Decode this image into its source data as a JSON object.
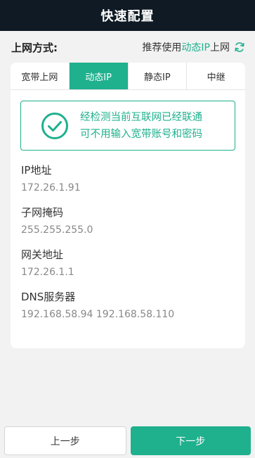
{
  "header": {
    "title": "快速配置"
  },
  "mode_row": {
    "label": "上网方式:",
    "recommend_prefix": "推荐使用",
    "recommend_accent": "动态IP",
    "recommend_suffix": "上网",
    "refresh_icon": "refresh-icon"
  },
  "tabs": [
    {
      "label": "宽带上网",
      "active": false
    },
    {
      "label": "动态IP",
      "active": true
    },
    {
      "label": "静态IP",
      "active": false
    },
    {
      "label": "中继",
      "active": false
    }
  ],
  "notice": {
    "icon": "check-circle-icon",
    "line1": "经检测当前互联网已经联通",
    "line2": "可不用输入宽带账号和密码"
  },
  "fields": [
    {
      "label": "IP地址",
      "value": "172.26.1.91"
    },
    {
      "label": "子网掩码",
      "value": "255.255.255.0"
    },
    {
      "label": "网关地址",
      "value": "172.26.1.1"
    },
    {
      "label": "DNS服务器",
      "value": "192.168.58.94 192.168.58.110"
    }
  ],
  "footer": {
    "prev_label": "上一步",
    "next_label": "下一步"
  },
  "colors": {
    "accent": "#1fb08d",
    "header_bg": "#0f1a24",
    "page_bg": "#f2f2f2"
  }
}
